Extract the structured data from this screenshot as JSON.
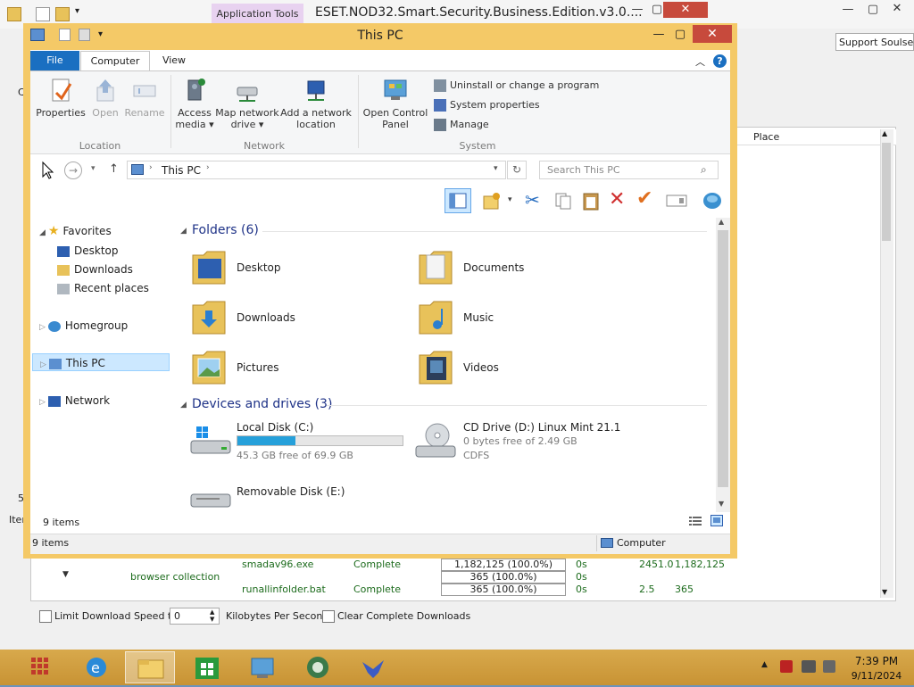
{
  "background_window": {
    "app_tools_tab": "Application Tools",
    "title": "ESET.NOD32.Smart.Security.Business.Edition.v3.0....",
    "support_label": "Support Soulseek",
    "place_header": "Place",
    "side_char_1": "C",
    "side_char_2": "5",
    "side_char_3": "Iten",
    "rows": [
      {
        "user": "",
        "file": "smadav96.exe",
        "status": "Complete",
        "progress": "1,182,125 (100.0%)",
        "time": "0s",
        "speed": "2451.0",
        "size": "1,182,125"
      },
      {
        "user": "browser collection",
        "file": "",
        "status": "",
        "progress": "365 (100.0%)",
        "time": "0s",
        "speed": "",
        "size": ""
      },
      {
        "user": "",
        "file": "runallinfolder.bat",
        "status": "Complete",
        "progress": "365 (100.0%)",
        "time": "0s",
        "speed": "2.5",
        "size": "365"
      }
    ],
    "bottom": {
      "limit_label": "Limit Download Speed to",
      "limit_value": "0",
      "unit_label": "Kilobytes Per Second",
      "clear_label": "Clear Complete Downloads"
    }
  },
  "explorer": {
    "title": "This PC",
    "tabs": {
      "file": "File",
      "computer": "Computer",
      "view": "View"
    },
    "ribbon": {
      "location": {
        "label": "Location",
        "properties": "Properties",
        "open": "Open",
        "rename": "Rename"
      },
      "network": {
        "label": "Network",
        "access_media_1": "Access",
        "access_media_2": "media ▾",
        "map_drive_1": "Map network",
        "map_drive_2": "drive ▾",
        "add_location_1": "Add a network",
        "add_location_2": "location"
      },
      "system": {
        "label": "System",
        "control_panel_1": "Open Control",
        "control_panel_2": "Panel",
        "uninstall": "Uninstall or change a program",
        "system_properties": "System properties",
        "manage": "Manage"
      }
    },
    "address": {
      "path": "This PC",
      "search_placeholder": "Search This PC"
    },
    "nav": {
      "favorites": "Favorites",
      "desktop": "Desktop",
      "downloads": "Downloads",
      "recent": "Recent places",
      "homegroup": "Homegroup",
      "this_pc": "This PC",
      "network": "Network"
    },
    "folders_title": "Folders (6)",
    "folders": [
      "Desktop",
      "Documents",
      "Downloads",
      "Music",
      "Pictures",
      "Videos"
    ],
    "drives_title": "Devices and drives (3)",
    "drives": [
      {
        "name": "Local Disk (C:)",
        "sub": "45.3 GB free of 69.9 GB",
        "used_fraction": 0.352
      },
      {
        "name": "CD Drive (D:) Linux Mint 21.1",
        "sub": "0 bytes free of 2.49 GB",
        "sub2": "CDFS"
      },
      {
        "name": "Removable Disk (E:)"
      }
    ],
    "status_inner": "9 items",
    "status_outer": "9 items",
    "status_computer": "Computer"
  },
  "taskbar": {
    "time": "7:39 PM",
    "date": "9/11/2024"
  },
  "colors": {
    "accent": "#1a6fc1",
    "frame": "#f4c967",
    "taskbar": "#d4a143",
    "close": "#c74a3c"
  }
}
